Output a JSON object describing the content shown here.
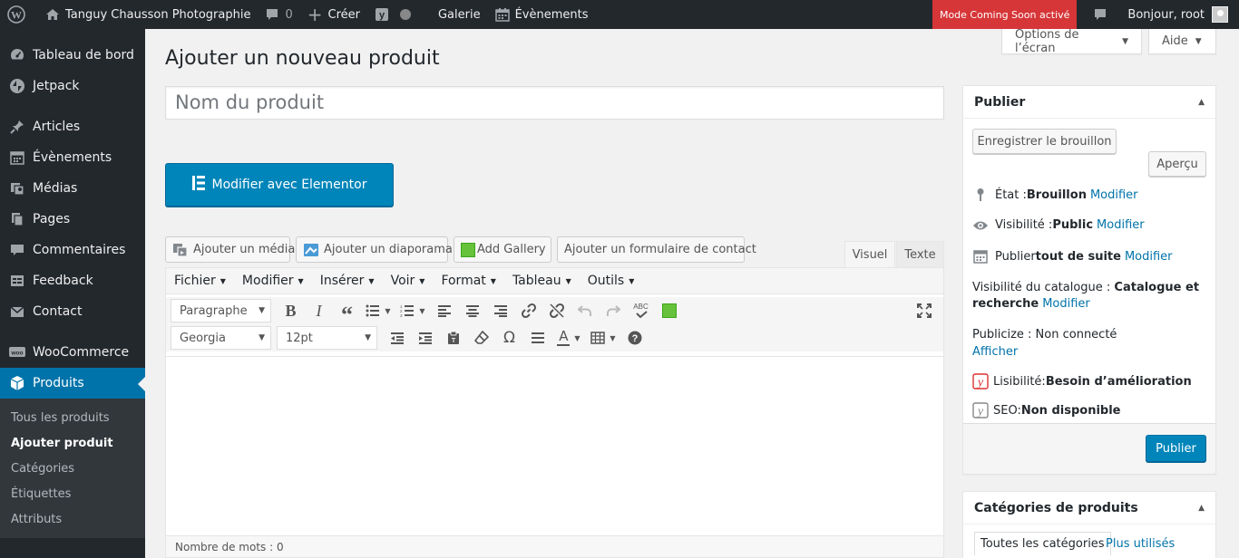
{
  "adminbar": {
    "site_name": "Tanguy Chausson Photographie",
    "comments_count": "0",
    "new_label": "Créer",
    "gallery_label": "Galerie",
    "events_label": "Évènements",
    "coming_soon": "Mode Coming Soon activé",
    "greeting": "Bonjour, root"
  },
  "sidebar": {
    "items": [
      {
        "label": "Tableau de bord",
        "icon": "dashboard-icon"
      },
      {
        "label": "Jetpack",
        "icon": "jetpack-icon"
      },
      {
        "label": "Articles",
        "icon": "pin-icon"
      },
      {
        "label": "Évènements",
        "icon": "calendar-icon"
      },
      {
        "label": "Médias",
        "icon": "media-icon"
      },
      {
        "label": "Pages",
        "icon": "pages-icon"
      },
      {
        "label": "Commentaires",
        "icon": "comments-icon"
      },
      {
        "label": "Feedback",
        "icon": "feedback-icon"
      },
      {
        "label": "Contact",
        "icon": "mail-icon"
      },
      {
        "label": "WooCommerce",
        "icon": "woocommerce-icon"
      },
      {
        "label": "Produits",
        "icon": "products-icon"
      }
    ],
    "submenu": [
      {
        "label": "Tous les produits"
      },
      {
        "label": "Ajouter produit"
      },
      {
        "label": "Catégories"
      },
      {
        "label": "Étiquettes"
      },
      {
        "label": "Attributs"
      }
    ]
  },
  "header": {
    "screen_options": "Options de l’écran",
    "help": "Aide",
    "title": "Ajouter un nouveau produit"
  },
  "product": {
    "name_placeholder": "Nom du produit",
    "elementor_label": "Modifier avec Elementor"
  },
  "media_buttons": {
    "add_media": "Ajouter un média",
    "add_slideshow": "Ajouter un diaporama",
    "add_gallery": "Add Gallery",
    "add_contact_form": "Ajouter un formulaire de contact"
  },
  "editor": {
    "tab_visual": "Visuel",
    "tab_text": "Texte",
    "menus": [
      "Fichier",
      "Modifier",
      "Insérer",
      "Voir",
      "Format",
      "Tableau",
      "Outils"
    ],
    "format_select": "Paragraphe",
    "font_select": "Georgia",
    "size_select": "12pt",
    "word_count": "Nombre de mots : 0",
    "spellcheck_label": "ABC"
  },
  "publish": {
    "title": "Publier",
    "save_draft": "Enregistrer le brouillon",
    "preview": "Aperçu",
    "status_label": "État : ",
    "status_value": "Brouillon",
    "visibility_label": "Visibilité : ",
    "visibility_value": "Public",
    "publish_label": "Publier ",
    "publish_value": "tout de suite",
    "edit_link": "Modifier",
    "catalog_label": "Visibilité du catalogue : ",
    "catalog_value_1": "Catalogue et",
    "catalog_value_2": "recherche",
    "publicize_label": "Publicize : Non connecté",
    "publicize_link": "Afficher",
    "readability_label": "Lisibilité: ",
    "readability_value": "Besoin d’amélioration",
    "seo_label": "SEO: ",
    "seo_value": "Non disponible",
    "publish_button": "Publier"
  },
  "categories": {
    "title": "Catégories de produits",
    "tab_all": "Toutes les catégories",
    "tab_popular": "Plus utilisés"
  },
  "colors": {
    "accent": "#0073aa",
    "primary_button": "#0085ba",
    "adminbar": "#23282d",
    "coming_soon": "#d63638"
  }
}
